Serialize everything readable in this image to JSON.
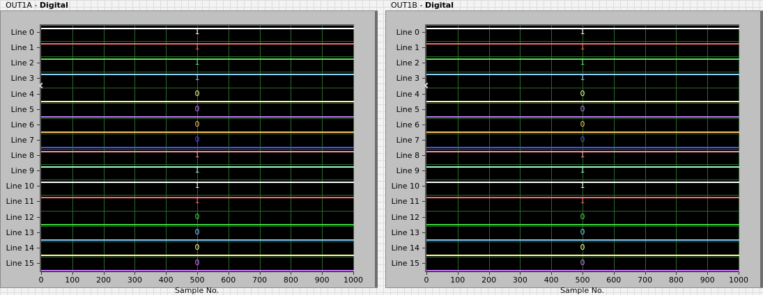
{
  "panels": [
    {
      "name": "OUT1A",
      "suffix": "Digital",
      "chart_data": {
        "type": "digital_waveform",
        "xlabel": "Sample No.",
        "xlim": [
          0,
          1000
        ],
        "x_ticks": [
          0,
          100,
          200,
          300,
          400,
          500,
          600,
          700,
          800,
          900,
          1000
        ],
        "lines": [
          {
            "label": "Line 0",
            "value": "1",
            "color": "#ffffff"
          },
          {
            "label": "Line 1",
            "value": "1",
            "color": "#ff6a6a"
          },
          {
            "label": "Line 2",
            "value": "1",
            "color": "#5fe35f"
          },
          {
            "label": "Line 3",
            "value": "1",
            "color": "#8fd0ff"
          },
          {
            "label": "Line 4",
            "value": "0",
            "color": "#ffff9a"
          },
          {
            "label": "Line 5",
            "value": "0",
            "color": "#c27bff"
          },
          {
            "label": "Line 6",
            "value": "0",
            "color": "#ffc261"
          },
          {
            "label": "Line 7",
            "value": "0",
            "color": "#4a4aff"
          },
          {
            "label": "Line 8",
            "value": "1",
            "color": "#ff8fa6"
          },
          {
            "label": "Line 9",
            "value": "1",
            "color": "#9fffd0"
          },
          {
            "label": "Line 10",
            "value": "1",
            "color": "#ffffff"
          },
          {
            "label": "Line 11",
            "value": "1",
            "color": "#ff6a6a"
          },
          {
            "label": "Line 12",
            "value": "0",
            "color": "#3fe03f"
          },
          {
            "label": "Line 13",
            "value": "0",
            "color": "#7ec9ff"
          },
          {
            "label": "Line 14",
            "value": "0",
            "color": "#ffff9a"
          },
          {
            "label": "Line 15",
            "value": "0",
            "color": "#d07bff"
          }
        ]
      }
    },
    {
      "name": "OUT1B",
      "suffix": "Digital",
      "chart_data": {
        "type": "digital_waveform",
        "xlabel": "Sample No.",
        "xlim": [
          0,
          1000
        ],
        "x_ticks": [
          0,
          100,
          200,
          300,
          400,
          500,
          600,
          700,
          800,
          900,
          1000
        ],
        "lines": [
          {
            "label": "Line 0",
            "value": "1",
            "color": "#ffffff"
          },
          {
            "label": "Line 1",
            "value": "1",
            "color": "#ff6a6a"
          },
          {
            "label": "Line 2",
            "value": "1",
            "color": "#5fe35f"
          },
          {
            "label": "Line 3",
            "value": "1",
            "color": "#8fd0ff"
          },
          {
            "label": "Line 4",
            "value": "0",
            "color": "#ffff9a"
          },
          {
            "label": "Line 5",
            "value": "0",
            "color": "#c27bff"
          },
          {
            "label": "Line 6",
            "value": "0",
            "color": "#ffc261"
          },
          {
            "label": "Line 7",
            "value": "0",
            "color": "#4a4aff"
          },
          {
            "label": "Line 8",
            "value": "1",
            "color": "#ff8fa6"
          },
          {
            "label": "Line 9",
            "value": "1",
            "color": "#9fffd0"
          },
          {
            "label": "Line 10",
            "value": "1",
            "color": "#ffffff"
          },
          {
            "label": "Line 11",
            "value": "1",
            "color": "#ff6a6a"
          },
          {
            "label": "Line 12",
            "value": "0",
            "color": "#3fe03f"
          },
          {
            "label": "Line 13",
            "value": "0",
            "color": "#7ec9ff"
          },
          {
            "label": "Line 14",
            "value": "0",
            "color": "#ffff9a"
          },
          {
            "label": "Line 15",
            "value": "0",
            "color": "#d07bff"
          }
        ]
      }
    }
  ]
}
